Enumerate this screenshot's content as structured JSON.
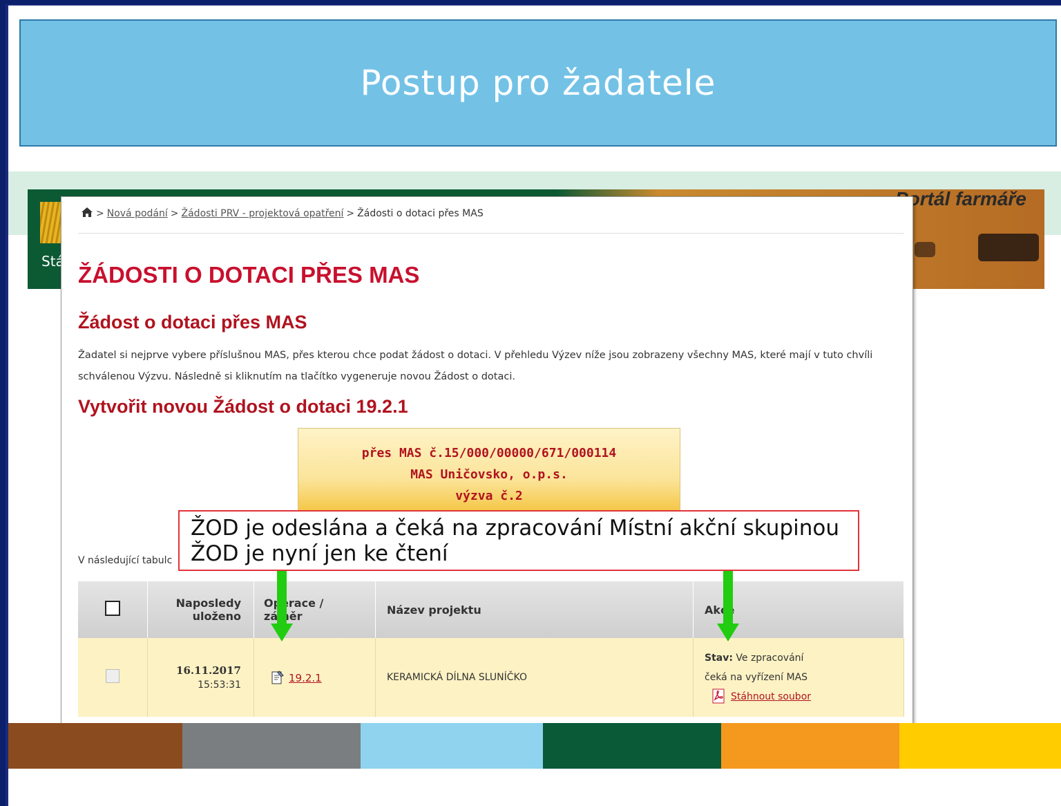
{
  "slide_title": "Postup pro žadatele",
  "portal": {
    "header_title": "Portál farmáře",
    "header_left_text": "Stá"
  },
  "breadcrumb": {
    "items": [
      "Nová podání",
      "Žádosti PRV - projektová opatření",
      "Žádosti o dotaci přes MAS"
    ]
  },
  "page": {
    "main_heading": "ŽÁDOSTI O DOTACI PŘES MAS",
    "sub_heading": "Žádost o dotaci přes MAS",
    "description": "Žadatel si nejprve vybere příslušnou MAS, přes kterou chce podat žádost o dotaci. V přehledu Výzev níže jsou zobrazeny všechny MAS, které mají v tuto chvíli schválenou Výzvu. Následně si kliknutím na tlačítko vygeneruje novou Žádost o dotaci.",
    "create_heading": "Vytvořit novou Žádost o dotaci 19.2.1",
    "mas_button": {
      "line1": "přes MAS č.15/000/00000/671/000114",
      "line2": "MAS Uničovsko, o.p.s.",
      "line3": "výzva č.2"
    },
    "following_text": "V následující tabulc"
  },
  "callout": {
    "line1": "ŽOD je odeslána a čeká na zpracování Místní akční skupinou",
    "line2": "ŽOD je nyní jen ke čtení"
  },
  "table": {
    "headers": {
      "saved_line1": "Naposledy",
      "saved_line2": "uloženo",
      "operation_line1": "Operace /",
      "operation_line2": "záměr",
      "project_name": "Název projektu",
      "actions": "Akce"
    },
    "rows": [
      {
        "date": "16.11.2017",
        "time": "15:53:31",
        "operation": "19.2.1",
        "project_name": "KERAMICKÁ DÍLNA SLUNÍČKO",
        "status_label": "Stav:",
        "status_value": "Ve zpracování",
        "status_detail": "čeká na vyřízení MAS",
        "download": "Stáhnout soubor"
      }
    ]
  },
  "colors": {
    "title_band": "#73c2e6",
    "accent_red": "#c8102e",
    "arrow_green": "#22cc11",
    "bar": [
      "#8a4b1e",
      "#7b7e80",
      "#8fd3ee",
      "#0a5a38",
      "#f5981e",
      "#ffcc00"
    ]
  }
}
